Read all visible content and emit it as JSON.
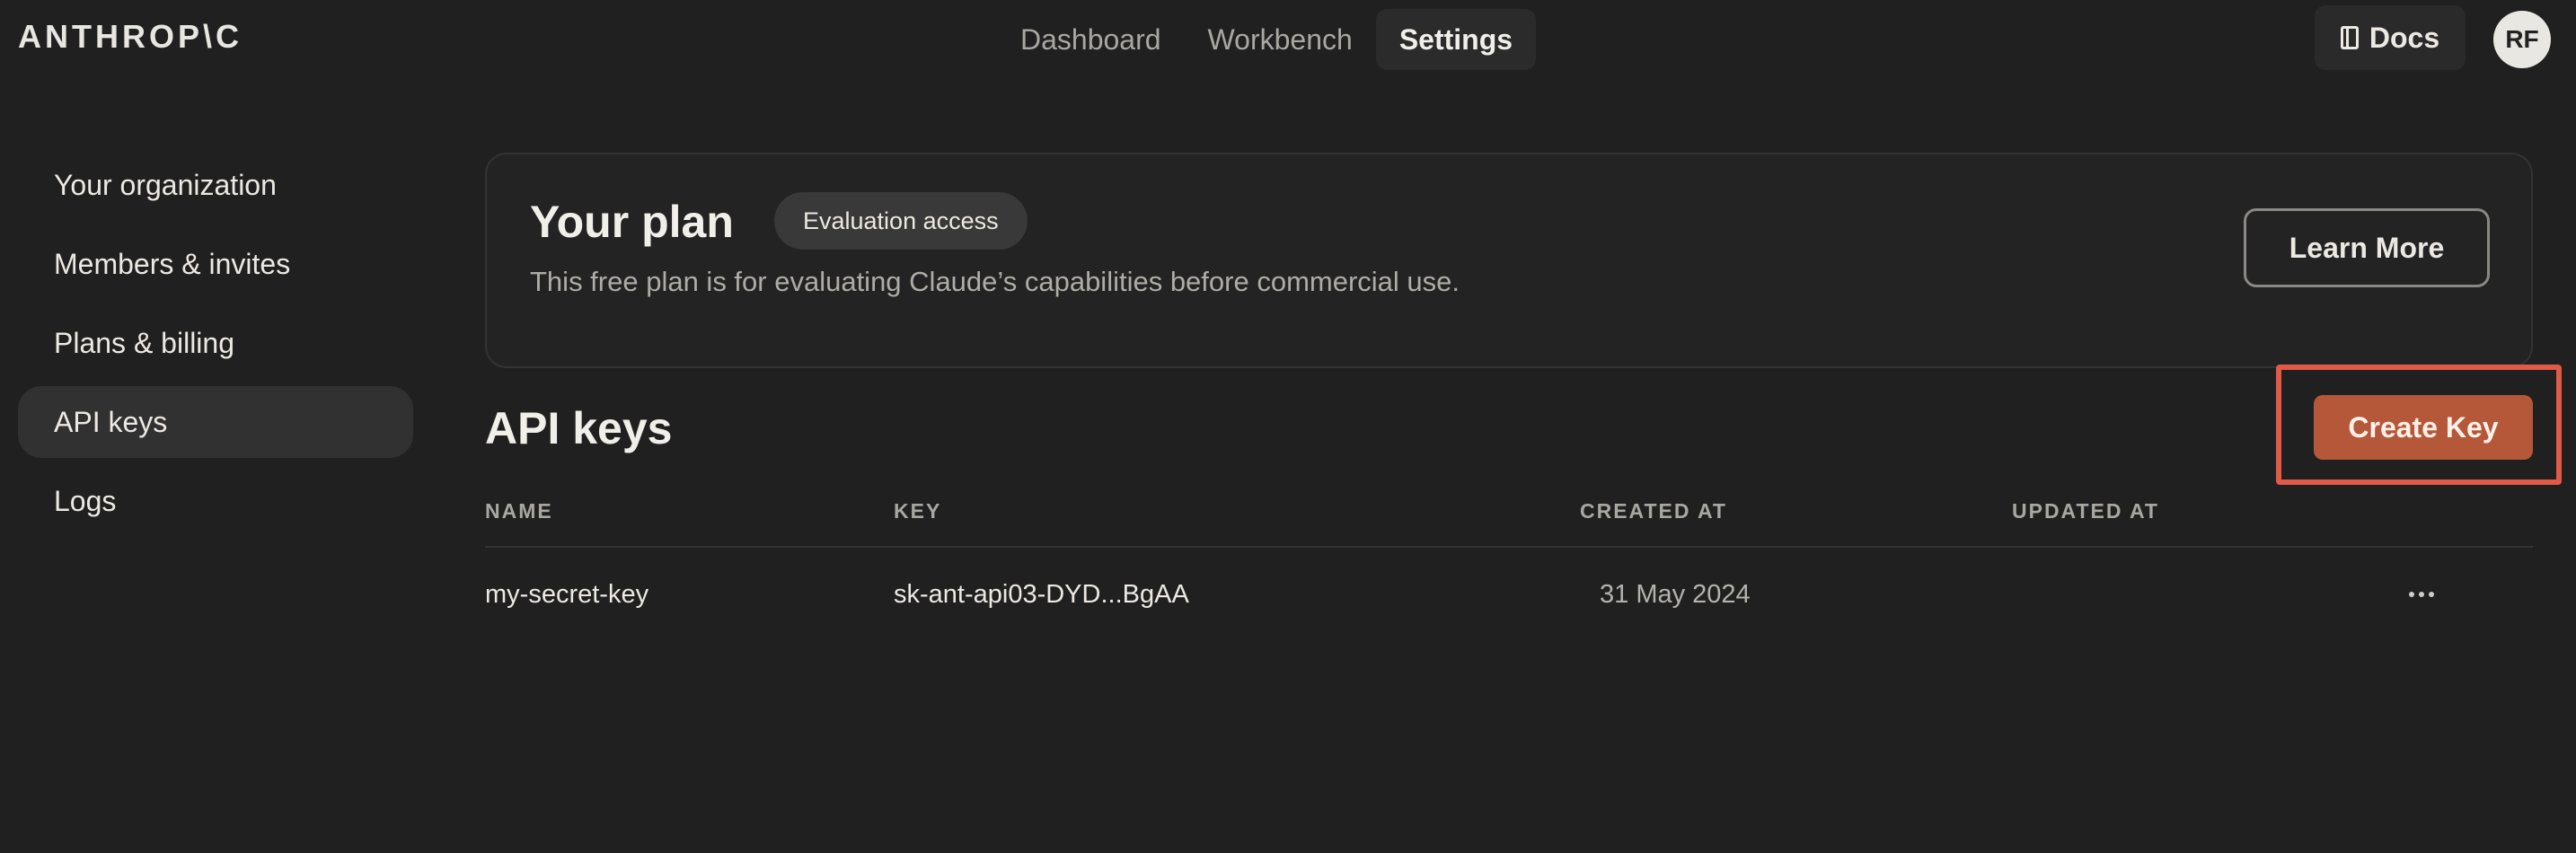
{
  "header": {
    "logo": "ANTHROP\\C",
    "nav": [
      "Dashboard",
      "Workbench",
      "Settings"
    ],
    "active_nav": "Settings",
    "docs_label": "Docs",
    "avatar_initials": "RF"
  },
  "sidebar": {
    "items": [
      {
        "label": "Your organization"
      },
      {
        "label": "Members & invites"
      },
      {
        "label": "Plans & billing"
      },
      {
        "label": "API keys"
      },
      {
        "label": "Logs"
      }
    ],
    "active_item": "API keys"
  },
  "plan": {
    "title": "Your plan",
    "badge": "Evaluation access",
    "description": "This free plan is for evaluating Claude’s capabilities before commercial use.",
    "learn_more_label": "Learn More"
  },
  "api_keys": {
    "title": "API keys",
    "create_label": "Create Key",
    "columns": [
      "NAME",
      "KEY",
      "CREATED AT",
      "UPDATED AT"
    ],
    "rows": [
      {
        "name": "my-secret-key",
        "key": "sk-ant-api03-DYD...BgAA",
        "created_at": "31 May 2024",
        "updated_at": ""
      }
    ]
  },
  "icons": {
    "docs": "book-icon",
    "row_menu": "more-horizontal-icon"
  },
  "colors": {
    "background": "#202020",
    "accent": "#b5583a",
    "highlight_outline": "#e05a47"
  }
}
